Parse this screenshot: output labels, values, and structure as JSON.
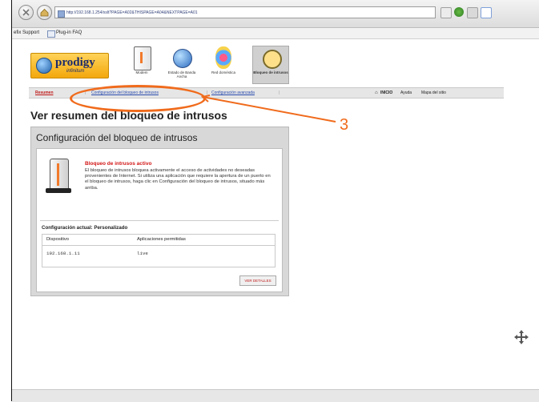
{
  "browser": {
    "url": "http://192.168.1.254/xslt?PAGE=A02&THISPAGE=A04&NEXTPAGE=A01",
    "bookmarks": [
      "efix Support",
      "Plug-in FAQ"
    ]
  },
  "brand": {
    "name": "prodigy",
    "tagline": "infinitum"
  },
  "nav_icons": [
    {
      "label": "Modem"
    },
    {
      "label": "Estado de Banda Ancha"
    },
    {
      "label": "Red doméstica"
    },
    {
      "label": "Bloqueo de intrusos"
    }
  ],
  "subnav": {
    "resumen": "Resumen",
    "configuracion": "Configuración del bloqueo de intrusos",
    "avanzada": "Configuración avanzada",
    "inicio": "INICIO",
    "ayuda": "Ayuda",
    "mapa": "Mapa del sitio"
  },
  "annotation": {
    "step_number": "3",
    "color": "#f06b1c"
  },
  "page_title": "Ver resumen del bloqueo de intrusos",
  "panel": {
    "title": "Configuración del bloqueo de intrusos",
    "status_title": "Bloqueo de intrusos activo",
    "description": "El bloqueo de intrusos bloquea activamente el acceso de actividades no deseadas provenientes de Internet. Si utiliza una aplicación que requiere la apertura de un puerto en el bloqueo de intrusos, haga clic en Configuración del bloqueo de intrusos, situado más arriba.",
    "current_config": "Configuración actual: Personalizado",
    "table": {
      "headers": [
        "Dispositivo",
        "Aplicaciones permitidas"
      ],
      "rows": [
        [
          "192.168.1.11",
          "live"
        ]
      ]
    },
    "details_button": "VER DETALLES"
  }
}
